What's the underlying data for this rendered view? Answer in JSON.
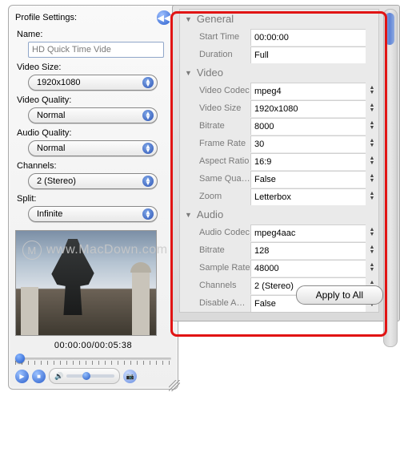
{
  "left": {
    "profile_label": "Profile Settings:",
    "name_label": "Name:",
    "name_value": "HD Quick Time Vide",
    "video_size_label": "Video Size:",
    "video_size_value": "1920x1080",
    "video_quality_label": "Video Quality:",
    "video_quality_value": "Normal",
    "audio_quality_label": "Audio Quality:",
    "audio_quality_value": "Normal",
    "channels_label": "Channels:",
    "channels_value": "2 (Stereo)",
    "split_label": "Split:",
    "split_value": "Infinite",
    "timecode": "00:00:00/00:05:38"
  },
  "right": {
    "sections": {
      "general": "General",
      "video": "Video",
      "audio": "Audio"
    },
    "props": {
      "start_time_k": "Start Time",
      "start_time_v": "00:00:00",
      "duration_k": "Duration",
      "duration_v": "Full",
      "vcodec_k": "Video Codec",
      "vcodec_v": "mpeg4",
      "vsize_k": "Video Size",
      "vsize_v": "1920x1080",
      "vbitrate_k": "Bitrate",
      "vbitrate_v": "8000",
      "fps_k": "Frame Rate",
      "fps_v": "30",
      "aspect_k": "Aspect Ratio",
      "aspect_v": "16:9",
      "sameq_k": "Same Qua…",
      "sameq_v": "False",
      "zoom_k": "Zoom",
      "zoom_v": "Letterbox",
      "acodec_k": "Audio Codec",
      "acodec_v": "mpeg4aac",
      "abitrate_k": "Bitrate",
      "abitrate_v": "128",
      "srate_k": "Sample Rate",
      "srate_v": "48000",
      "achan_k": "Channels",
      "achan_v": "2 (Stereo)",
      "disa_k": "Disable A…",
      "disa_v": "False"
    },
    "apply": "Apply to All"
  },
  "watermark": "www.MacDown.com"
}
